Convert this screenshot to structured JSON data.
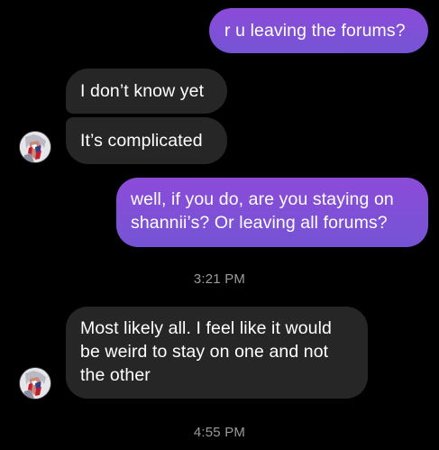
{
  "conversation": {
    "messages": [
      {
        "direction": "outgoing",
        "text": "r u leaving the forums?"
      },
      {
        "direction": "incoming",
        "text": "I don’t know yet"
      },
      {
        "direction": "incoming",
        "text": "It’s complicated"
      },
      {
        "direction": "outgoing",
        "text": "well, if you do, are you staying on shannii’s? Or leaving all forums?"
      },
      {
        "direction": "incoming",
        "text": "Most likely all. I feel like it would be weird to stay on one and not the other"
      }
    ],
    "timestamps": [
      "3:21 PM",
      "4:55 PM"
    ],
    "contact": {
      "avatar_icon": "contact-avatar-icon"
    }
  },
  "colors": {
    "background": "#000000",
    "outgoing_bubble_top": "#8c4bd9",
    "outgoing_bubble_bottom": "#7454d4",
    "incoming_bubble": "#262626",
    "timestamp_text": "#9b9b9b",
    "message_text": "#ffffff"
  }
}
